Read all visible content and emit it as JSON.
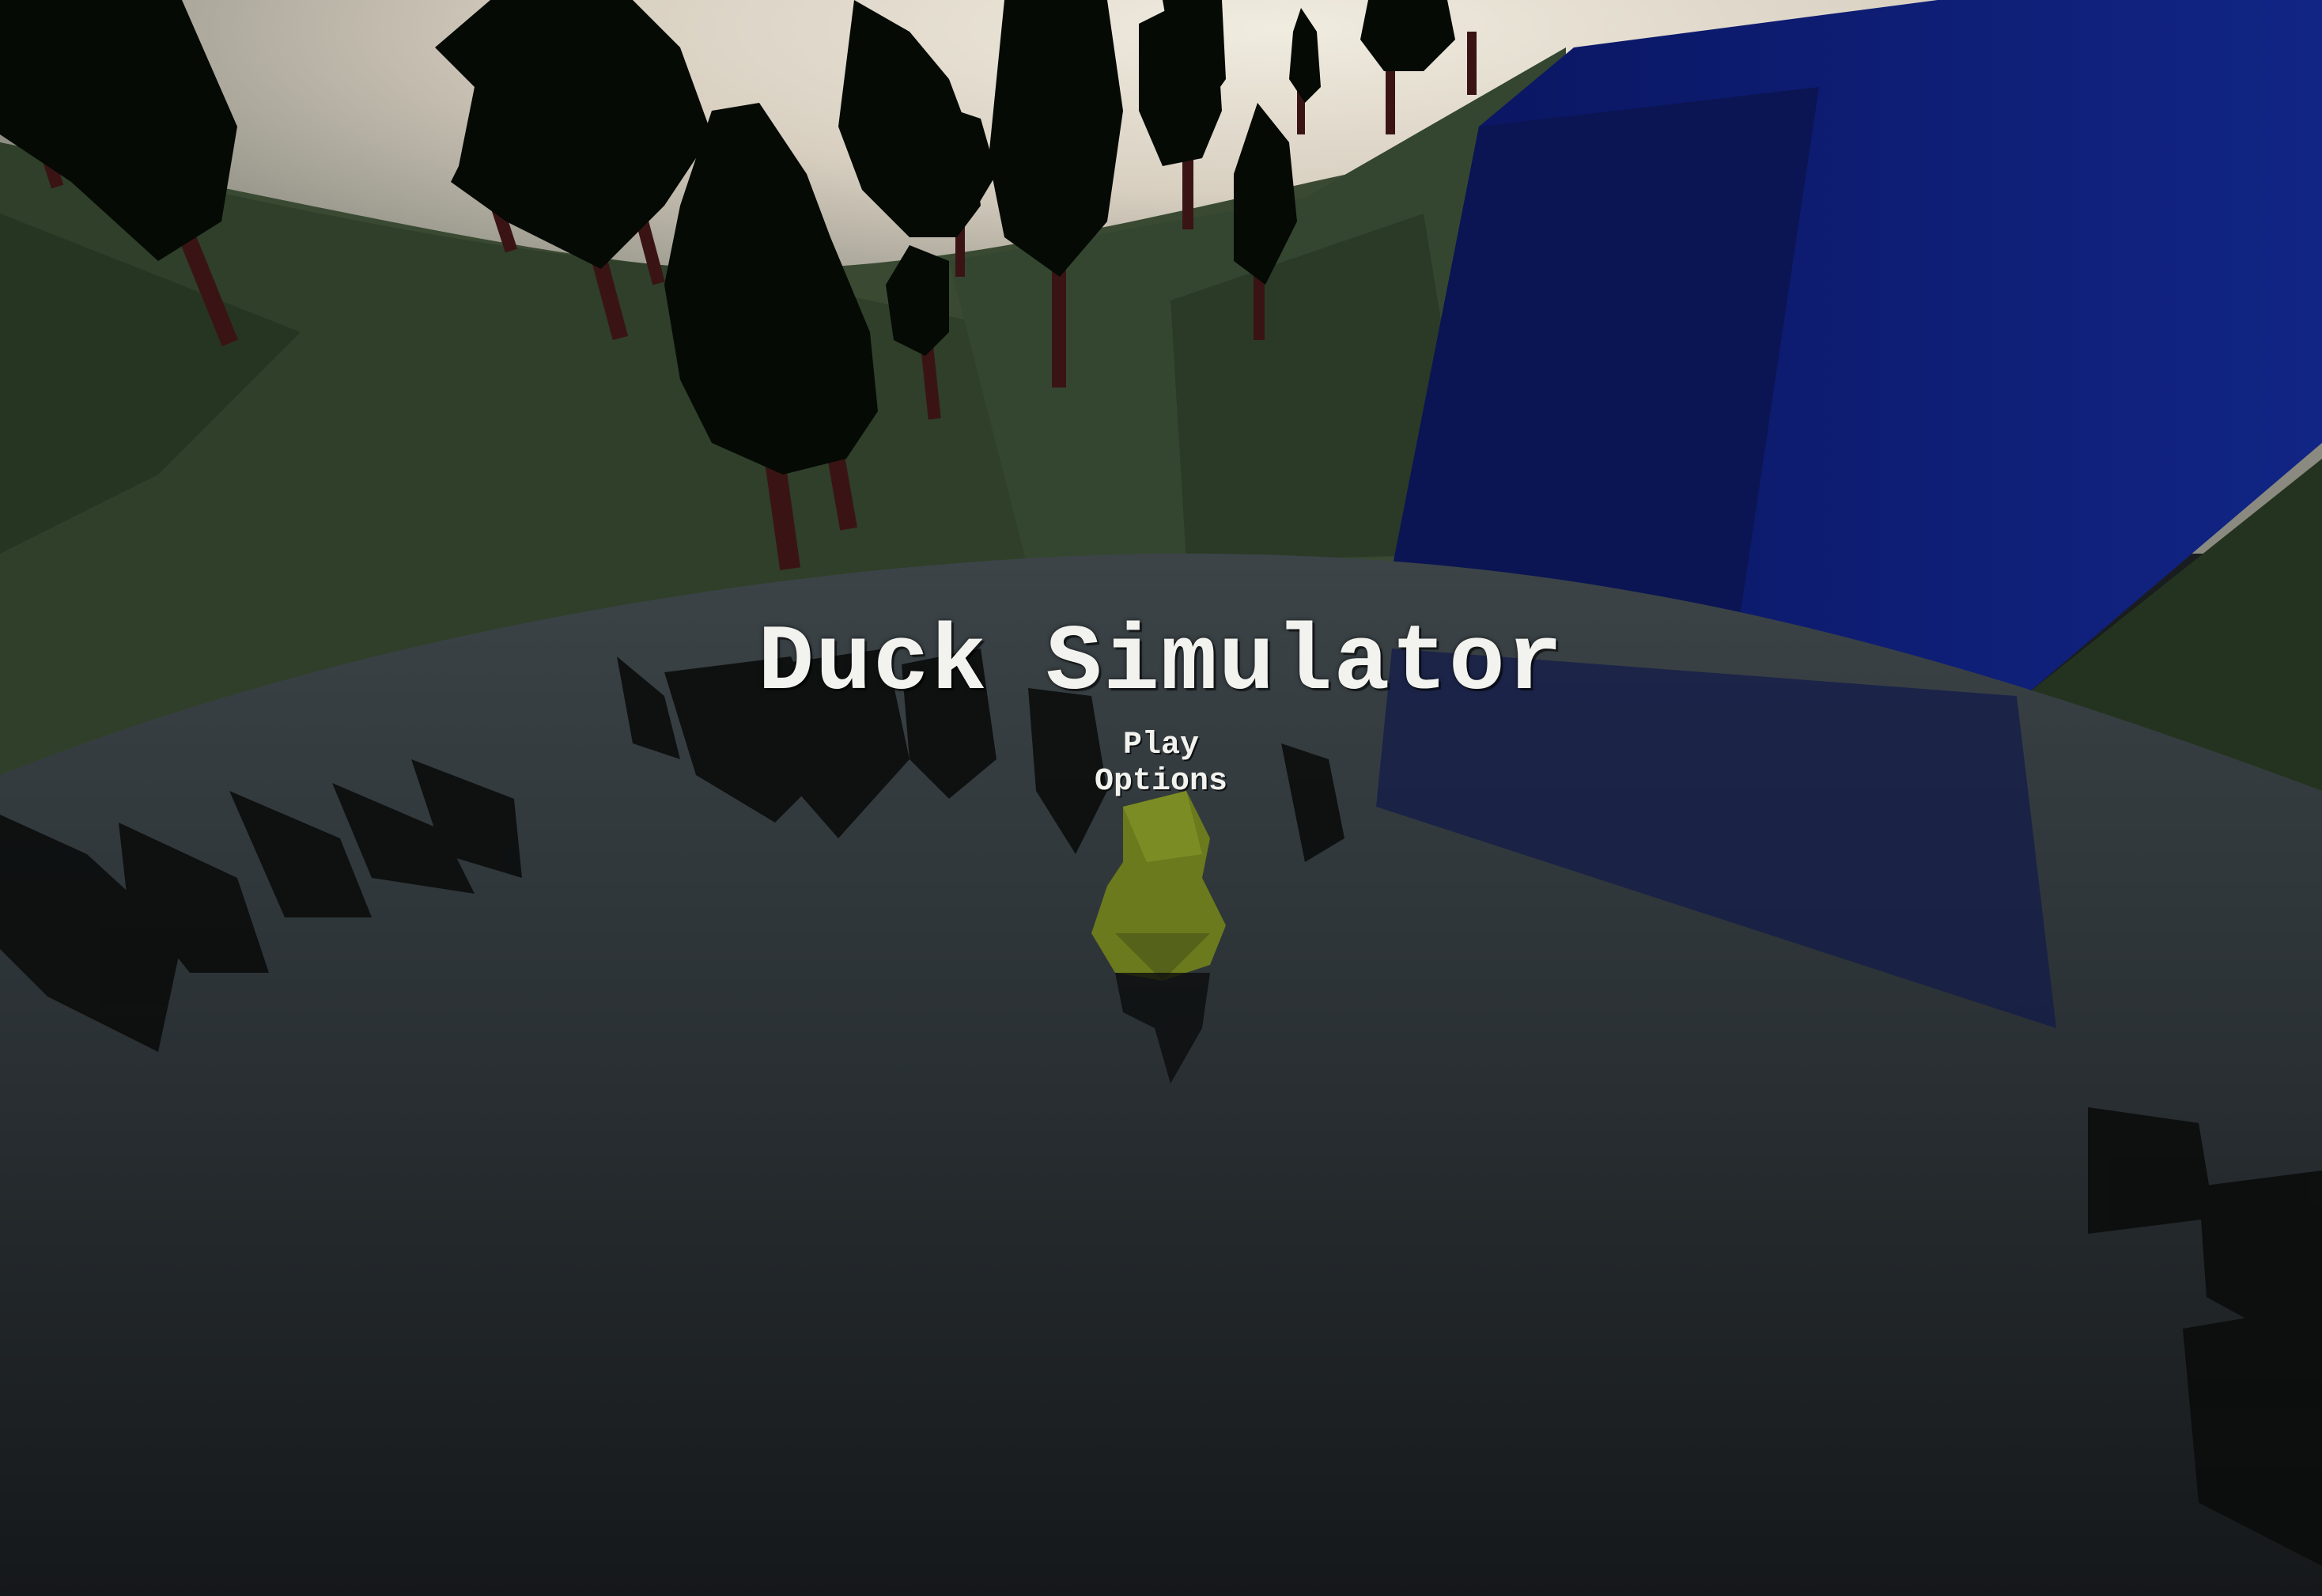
{
  "game": {
    "title": "Duck Simulator"
  },
  "menu": {
    "items": [
      {
        "label": "Play",
        "id": "play"
      },
      {
        "label": "Options",
        "id": "options"
      }
    ]
  },
  "scene": {
    "sky_color": "#e9e6dc",
    "hill_color": "#2c3a26",
    "water_color": "#2b3136",
    "waterfall_color": "#0f1d6b",
    "tree_color": "#050a05",
    "trunk_color": "#3a1414",
    "duck_color": "#6b7a1c"
  }
}
